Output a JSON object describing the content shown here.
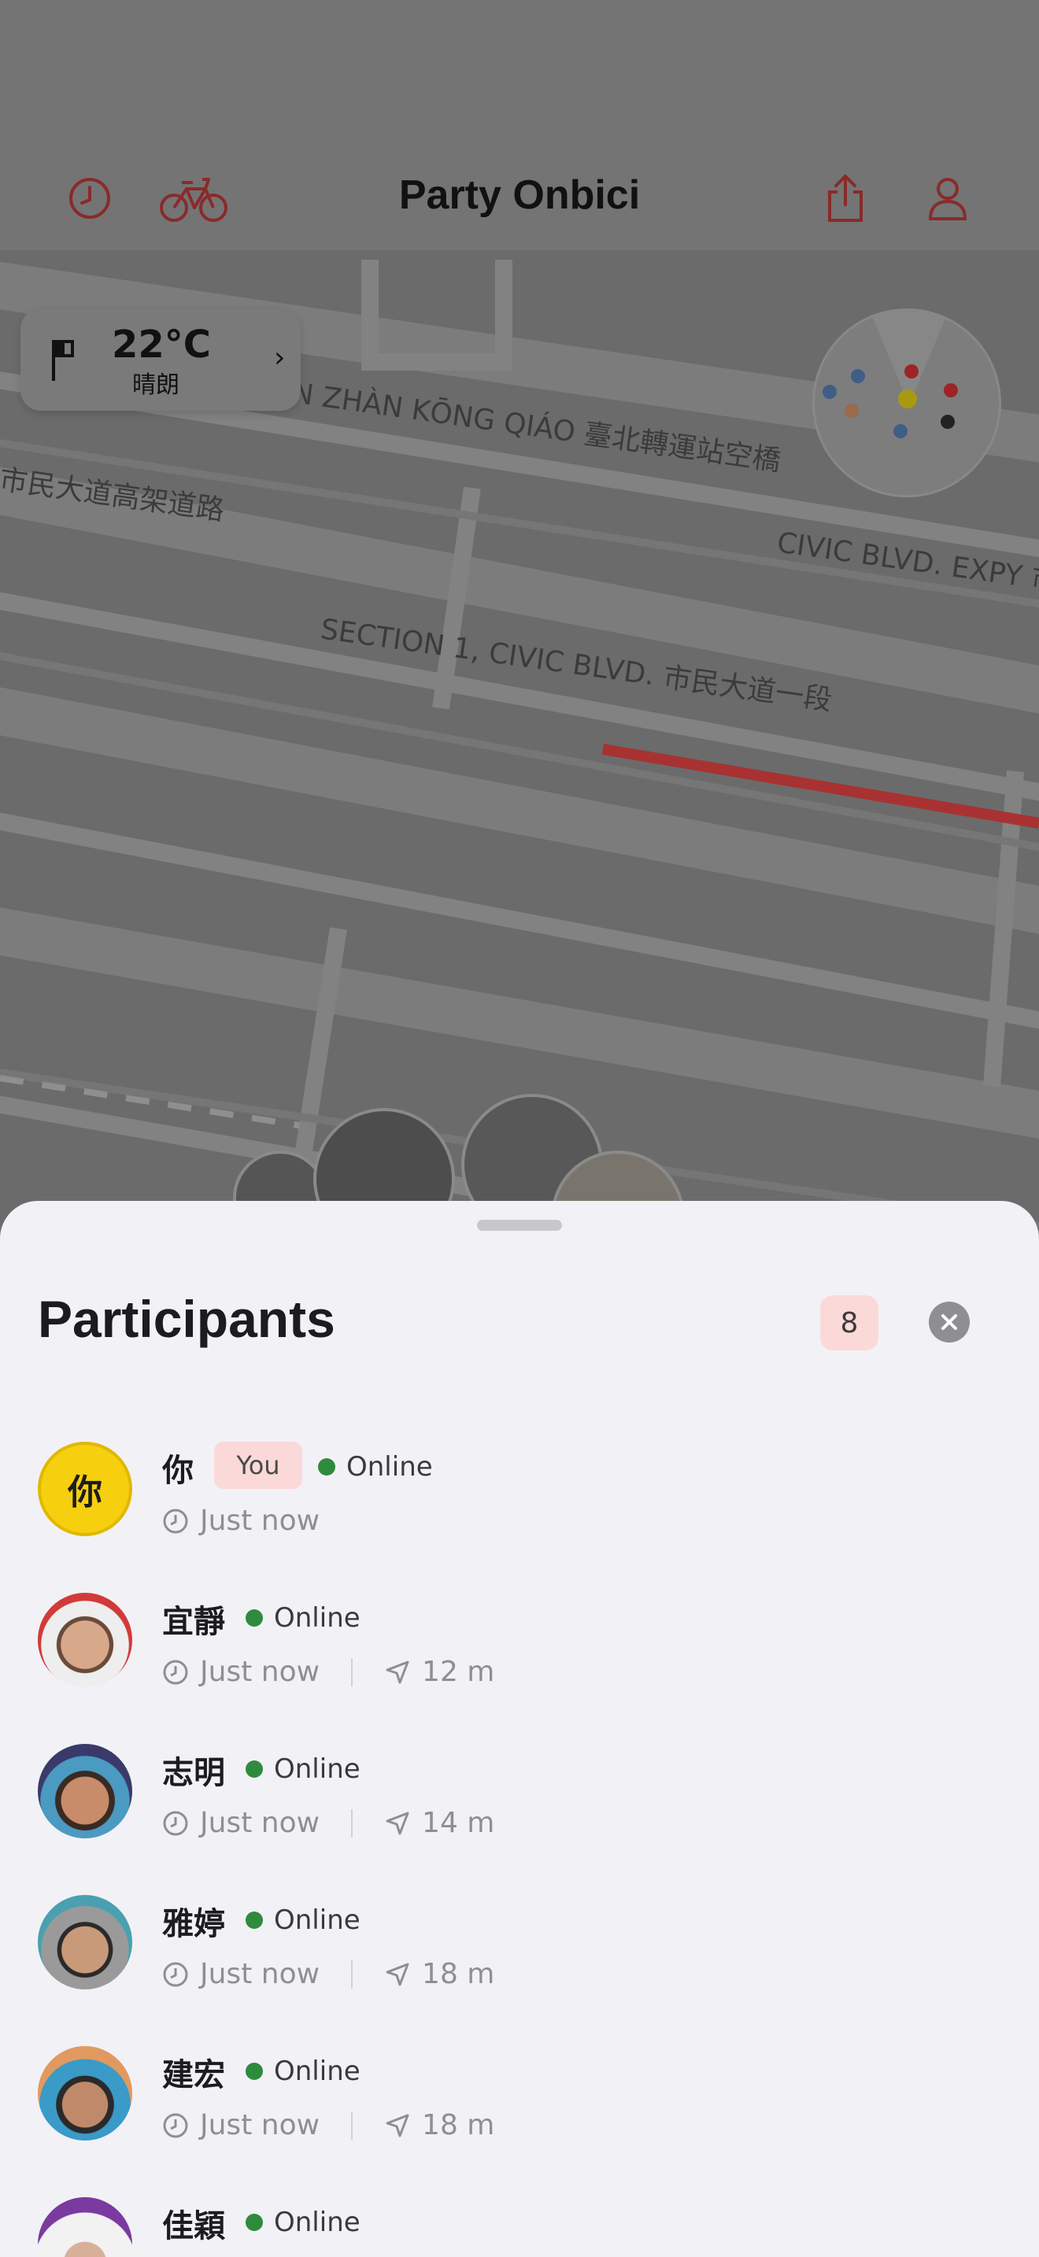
{
  "app": {
    "title": "Party Onbici"
  },
  "weather": {
    "temperature": "22°C",
    "condition": "晴朗"
  },
  "map": {
    "labels": [
      "N ZHÀN KŌNG QIÁO 臺北轉運站空橋",
      "市民大道高架道路",
      "CIVIC BLVD. EXPY 市",
      "SECTION 1, CIVIC BLVD. 市民大道一段"
    ]
  },
  "colors": {
    "accent": "#9b1c1c",
    "online": "#2e8b3e",
    "badge_bg": "#fcd9d9",
    "route": "#a83232"
  },
  "sheet": {
    "heading": "Participants",
    "count": "8"
  },
  "participants": [
    {
      "name": "你",
      "is_you": true,
      "you_label": "You",
      "status": "Online",
      "last_seen": "Just now",
      "distance": "",
      "avatar_text": "你"
    },
    {
      "name": "宜靜",
      "is_you": false,
      "status": "Online",
      "last_seen": "Just now",
      "distance": "12 m"
    },
    {
      "name": "志明",
      "is_you": false,
      "status": "Online",
      "last_seen": "Just now",
      "distance": "14 m"
    },
    {
      "name": "雅婷",
      "is_you": false,
      "status": "Online",
      "last_seen": "Just now",
      "distance": "18 m"
    },
    {
      "name": "建宏",
      "is_you": false,
      "status": "Online",
      "last_seen": "Just now",
      "distance": "18 m"
    },
    {
      "name": "佳穎",
      "is_you": false,
      "status": "Online",
      "last_seen": "",
      "distance": ""
    }
  ]
}
